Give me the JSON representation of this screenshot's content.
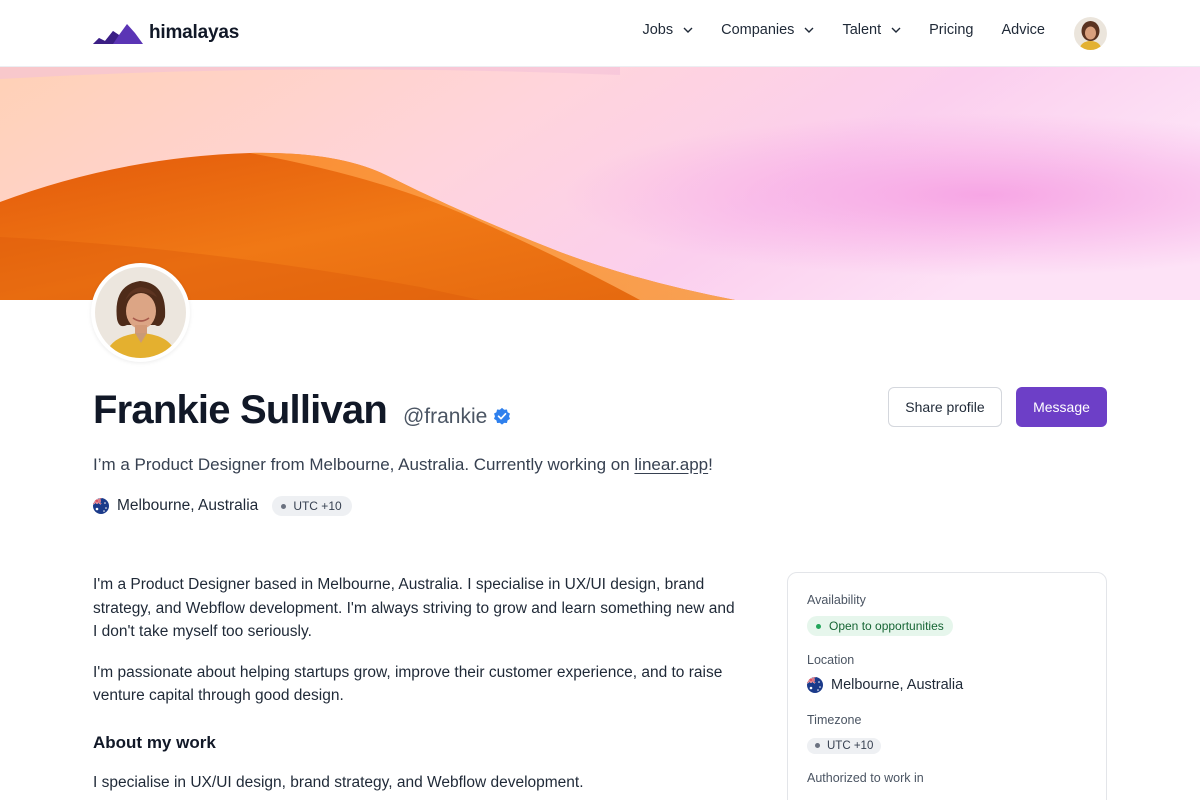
{
  "header": {
    "logo_text": "himalayas",
    "nav": [
      {
        "label": "Jobs",
        "has_dropdown": true
      },
      {
        "label": "Companies",
        "has_dropdown": true
      },
      {
        "label": "Talent",
        "has_dropdown": true
      },
      {
        "label": "Pricing",
        "has_dropdown": false
      },
      {
        "label": "Advice",
        "has_dropdown": false
      }
    ]
  },
  "profile": {
    "name": "Frankie Sullivan",
    "handle": "@frankie",
    "tagline_prefix": "I’m a Product Designer from Melbourne, Australia. Currently working on ",
    "tagline_link": "linear.app",
    "tagline_suffix": "!",
    "location": "Melbourne, Australia",
    "timezone": "UTC +10"
  },
  "actions": {
    "share_label": "Share profile",
    "message_label": "Message"
  },
  "about": {
    "paragraphs": [
      "I'm a Product Designer based in Melbourne, Australia. I specialise in UX/UI design, brand strategy, and Webflow development. I'm always striving to grow and learn something new and I don't take myself too seriously.",
      "I'm passionate about helping startups grow, improve their customer experience, and to raise venture capital through good design."
    ],
    "work_heading": "About my work",
    "work_text": "I specialise in UX/UI design, brand strategy, and Webflow development."
  },
  "sidebar_card": {
    "availability_label": "Availability",
    "availability_value": "Open to opportunities",
    "location_label": "Location",
    "location_value": "Melbourne, Australia",
    "timezone_label": "Timezone",
    "timezone_value": "UTC +10",
    "authorized_label": "Authorized to work in"
  },
  "colors": {
    "brand_purple": "#6d3fc7",
    "open_green": "#22a55a",
    "banner_orange": "#e8650f",
    "banner_pink": "#f7c6ec"
  },
  "icons": [
    "logo-mountains-icon",
    "chevron-down-icon",
    "verified-badge-icon",
    "australia-flag-icon"
  ]
}
